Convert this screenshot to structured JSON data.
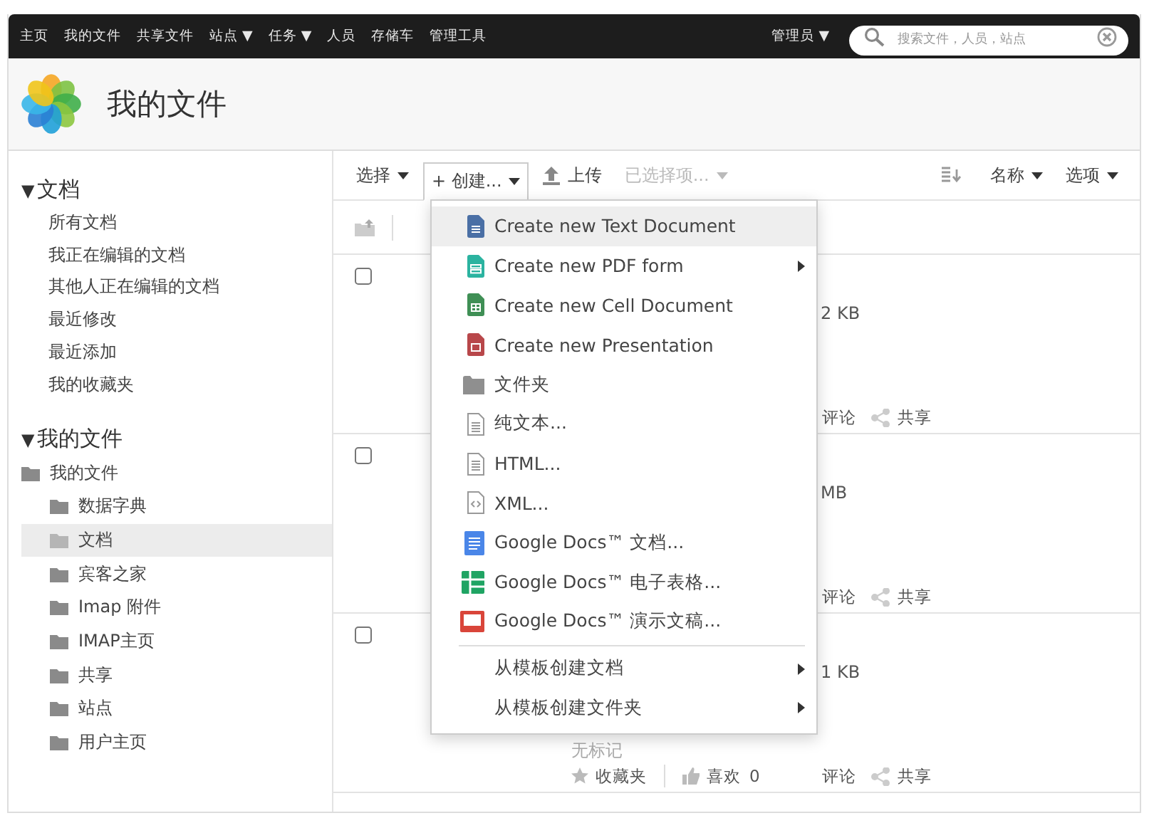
{
  "top_nav": {
    "items": [
      {
        "label": "主页"
      },
      {
        "label": "我的文件"
      },
      {
        "label": "共享文件"
      },
      {
        "label": "站点",
        "caret": "▼"
      },
      {
        "label": "任务",
        "caret": "▼"
      },
      {
        "label": "人员"
      },
      {
        "label": "存储车"
      },
      {
        "label": "管理工具"
      }
    ],
    "user_menu": {
      "label": "管理员",
      "caret": "▼"
    },
    "search": {
      "placeholder": "搜索文件，人员，站点"
    }
  },
  "header": {
    "title": "我的文件"
  },
  "sidebar": {
    "documents": {
      "caret": "▼",
      "title": "文档",
      "items": [
        "所有文档",
        "我正在编辑的文档",
        "其他人正在编辑的文档",
        "最近修改",
        "最近添加",
        "我的收藏夹"
      ]
    },
    "my_files": {
      "caret": "▼",
      "title": "我的文件",
      "tree": [
        {
          "label": "我的文件",
          "selected": false,
          "children": [
            {
              "label": "数据字典",
              "selected": false
            },
            {
              "label": "文档",
              "selected": true
            },
            {
              "label": "宾客之家",
              "selected": false
            },
            {
              "label": "Imap 附件",
              "selected": false
            },
            {
              "label": "IMAP主页",
              "selected": false
            },
            {
              "label": "共享",
              "selected": false
            },
            {
              "label": "站点",
              "selected": false
            },
            {
              "label": "用户主页",
              "selected": false
            }
          ]
        }
      ]
    }
  },
  "toolbar": {
    "select": "选择",
    "create": {
      "label": "+ 创建...",
      "pressed": true
    },
    "upload": "上传",
    "selected_items": {
      "label": "已选择项...",
      "disabled": true
    },
    "sort": "名称",
    "options": "选项"
  },
  "rows": [
    {
      "checked": false,
      "size": "2 KB",
      "comment": "评论",
      "share": "共享"
    },
    {
      "checked": false,
      "size": "MB",
      "comment": "评论",
      "share": "共享"
    },
    {
      "checked": false,
      "size": "1 KB",
      "tags": "无标记",
      "favorite": "收藏夹",
      "like": "喜欢",
      "likes": "0",
      "comment": "评论",
      "share": "共享"
    }
  ],
  "create_menu": {
    "groups": [
      [
        {
          "kind": "text-doc",
          "label": "Create new Text Document",
          "selected": true,
          "submenu": false
        },
        {
          "kind": "pdf-form",
          "label": "Create new PDF form",
          "selected": false,
          "submenu": true
        },
        {
          "kind": "cell-doc",
          "label": "Create new Cell Document",
          "selected": false,
          "submenu": false
        },
        {
          "kind": "presentation",
          "label": "Create new Presentation",
          "selected": false,
          "submenu": false
        },
        {
          "kind": "folder",
          "label": "文件夹",
          "selected": false,
          "submenu": false
        },
        {
          "kind": "plain-text",
          "label": "纯文本...",
          "selected": false,
          "submenu": false
        },
        {
          "kind": "html",
          "label": "HTML...",
          "selected": false,
          "submenu": false
        },
        {
          "kind": "xml",
          "label": "XML...",
          "selected": false,
          "submenu": false
        },
        {
          "kind": "google-doc",
          "label": "Google Docs™ 文档...",
          "selected": false,
          "submenu": false
        },
        {
          "kind": "google-sheet",
          "label": "Google Docs™ 电子表格...",
          "selected": false,
          "submenu": false
        },
        {
          "kind": "google-slides",
          "label": "Google Docs™ 演示文稿...",
          "selected": false,
          "submenu": false
        }
      ],
      [
        {
          "kind": "template",
          "label": "从模板创建文档",
          "selected": false,
          "submenu": true
        },
        {
          "kind": "template",
          "label": "从模板创建文件夹",
          "selected": false,
          "submenu": true
        }
      ]
    ]
  }
}
